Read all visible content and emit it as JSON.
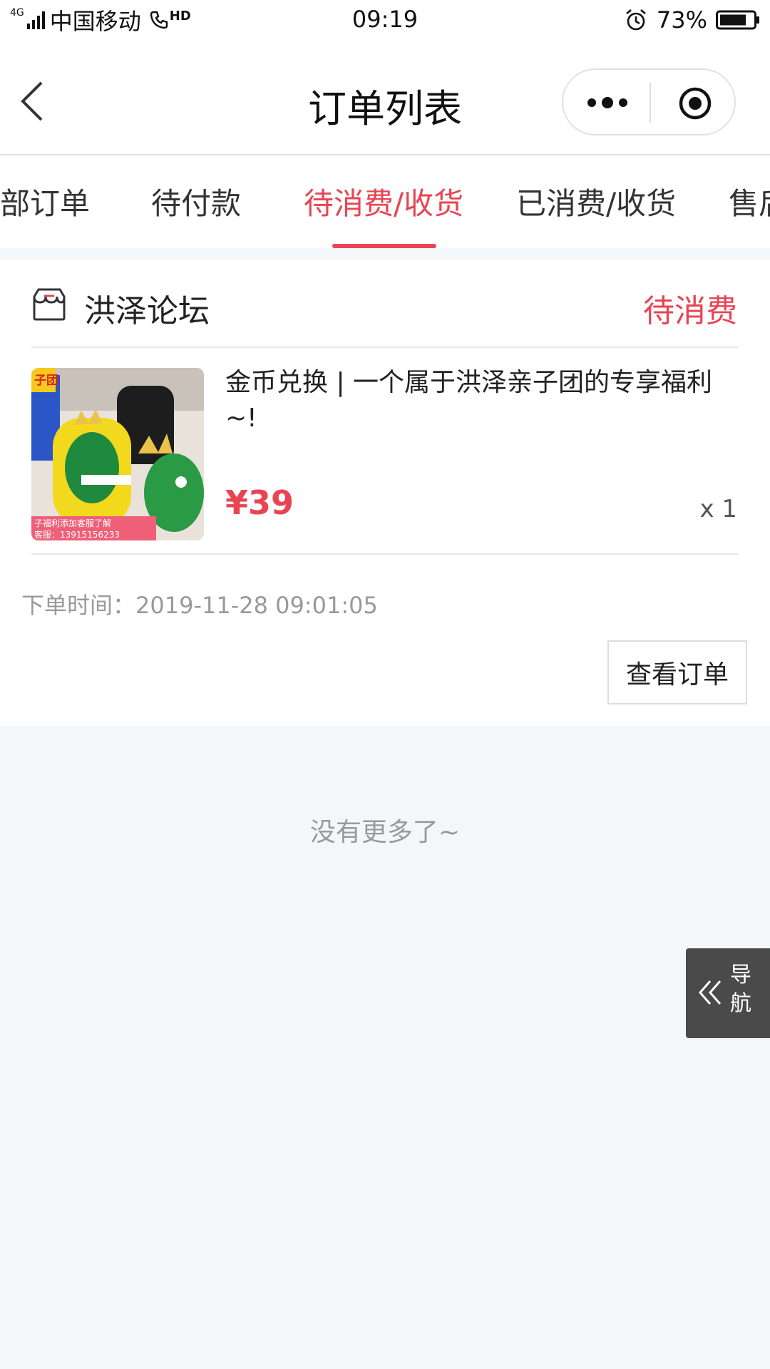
{
  "status_bar": {
    "network": "4G",
    "carrier": "中国移动",
    "hd": "HD",
    "time": "09:19",
    "battery": "73%"
  },
  "nav": {
    "title": "订单列表"
  },
  "tabs": [
    {
      "label": "全部订单"
    },
    {
      "label": "待付款"
    },
    {
      "label": "待消费/收货",
      "active": true
    },
    {
      "label": "已消费/收货"
    },
    {
      "label": "售后"
    }
  ],
  "order": {
    "shop_name": "洪泽论坛",
    "status": "待消费",
    "product_title": "金币兑换 | 一个属于洪泽亲子团的专享福利~!",
    "image_badge": "子团",
    "image_caption_1": "子福利添加客服了解",
    "image_caption_2": "客服：13915156233",
    "price": "¥39",
    "quantity": "x 1",
    "order_time": "下单时间：2019-11-28 09:01:05",
    "view_button": "查看订单"
  },
  "footer": {
    "no_more": "没有更多了~"
  },
  "float_nav": {
    "label": "导航"
  },
  "colors": {
    "accent": "#e94453",
    "background": "#f4f7fa"
  }
}
